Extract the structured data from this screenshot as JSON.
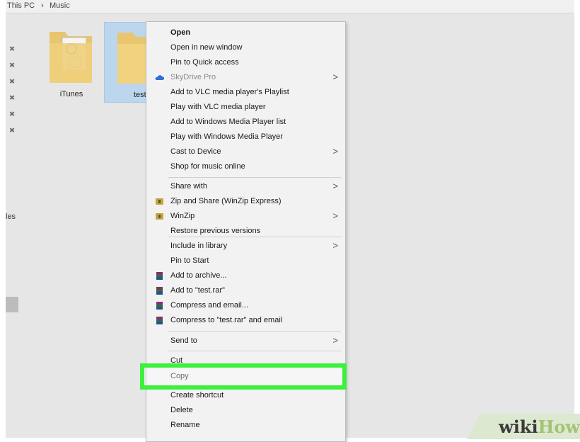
{
  "breadcrumb": {
    "part1": "This PC",
    "separator": "›",
    "part2": "Music"
  },
  "nav": {
    "partial_label": "les"
  },
  "folders": [
    {
      "name": "iTunes"
    },
    {
      "name": "test"
    }
  ],
  "context_menu": {
    "items": [
      {
        "label": "Open"
      },
      {
        "label": "Open in new window"
      },
      {
        "label": "Pin to Quick access"
      },
      {
        "label": "SkyDrive Pro",
        "disabled": true,
        "submenu": true,
        "icon": "cloud-icon"
      },
      {
        "label": "Add to VLC media player's Playlist"
      },
      {
        "label": "Play with VLC media player"
      },
      {
        "label": "Add to Windows Media Player list"
      },
      {
        "label": "Play with Windows Media Player"
      },
      {
        "label": "Cast to Device",
        "submenu": true
      },
      {
        "label": "Shop for music online"
      },
      {
        "label": "Share with",
        "submenu": true
      },
      {
        "label": "Zip and Share (WinZip Express)",
        "icon": "winzip-icon"
      },
      {
        "label": "WinZip",
        "submenu": true,
        "icon": "winzip-icon"
      },
      {
        "label": "Restore previous versions"
      },
      {
        "label": "Include in library",
        "submenu": true
      },
      {
        "label": "Pin to Start"
      },
      {
        "label": "Add to archive...",
        "icon": "winrar-icon"
      },
      {
        "label": "Add to \"test.rar\"",
        "icon": "winrar-icon"
      },
      {
        "label": "Compress and email...",
        "icon": "winrar-icon"
      },
      {
        "label": "Compress to \"test.rar\" and email",
        "icon": "winrar-icon"
      },
      {
        "label": "Send to",
        "submenu": true
      },
      {
        "label": "Cut"
      },
      {
        "label": "Copy",
        "highlighted": true
      },
      {
        "label": "Create shortcut"
      },
      {
        "label": "Delete"
      },
      {
        "label": "Rename"
      }
    ],
    "submenu_arrow": ">"
  },
  "highlight_color": "#3df03d",
  "watermark": {
    "wiki": "wiki",
    "how": "How"
  }
}
